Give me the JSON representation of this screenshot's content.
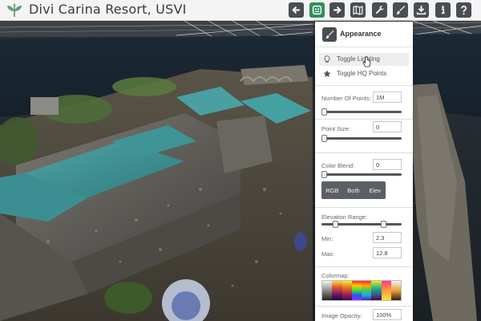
{
  "app": {
    "title": "Divi Carina Resort, USVI"
  },
  "toolbar": {
    "buttons": [
      {
        "icon": "arrow-left-icon"
      },
      {
        "icon": "appearance-icon",
        "active": true
      },
      {
        "icon": "arrow-right-icon"
      },
      {
        "icon": "map-icon"
      },
      {
        "icon": "wrench-icon"
      },
      {
        "icon": "brush-icon"
      },
      {
        "icon": "download-icon"
      },
      {
        "icon": "info-icon"
      },
      {
        "icon": "help-icon"
      }
    ],
    "active_color": "#2f8f5c",
    "button_color": "#4a4e52"
  },
  "panel": {
    "title": "Appearance",
    "menu": [
      {
        "label": "Toggle Lighting",
        "icon": "lightbulb-icon"
      },
      {
        "label": "Toggle HQ Points",
        "icon": "star-icon"
      }
    ],
    "number_of_points": {
      "label": "Number Of Points:",
      "value": "1M"
    },
    "point_size": {
      "label": "Point Size:",
      "value": "0"
    },
    "color_blend": {
      "label": "Color Blend:",
      "value": "0"
    },
    "color_mode": {
      "options": [
        "RGB",
        "Both",
        "Elev"
      ]
    },
    "elevation_range": {
      "label": "Elevation Range:",
      "min_label": "Min:",
      "min_value": "2.3",
      "max_label": "Max:",
      "max_value": "12.8"
    },
    "colormap": {
      "label": "Colormap:"
    },
    "image_opacity": {
      "label": "Image Opacity:",
      "value": "100%"
    }
  }
}
